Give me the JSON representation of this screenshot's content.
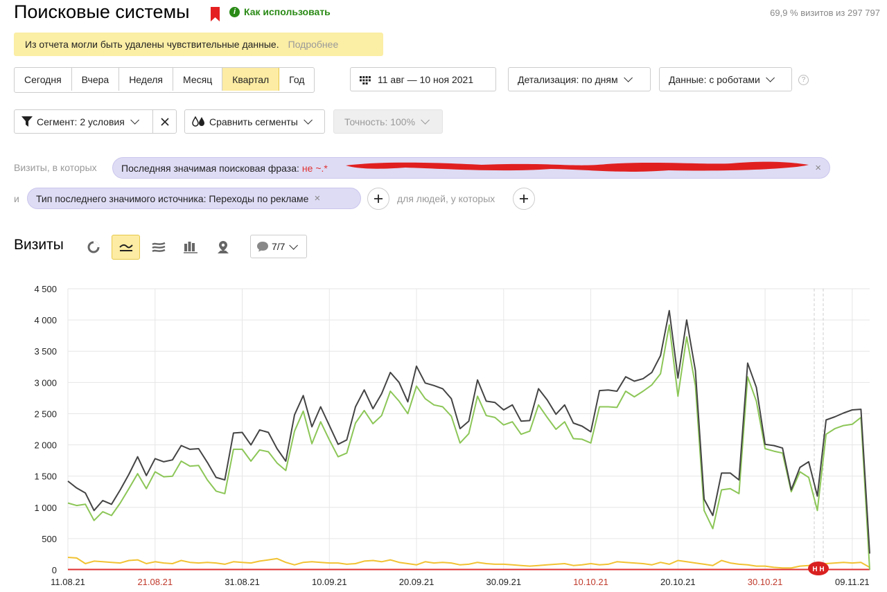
{
  "header": {
    "title": "Поисковые системы",
    "how_to_use": "Как использовать",
    "visits_summary": "69,9 % визитов из 297 797"
  },
  "notice": {
    "text": "Из отчета могли быть удалены чувствительные данные.",
    "more_link": "Подробнее"
  },
  "periods": [
    "Сегодня",
    "Вчера",
    "Неделя",
    "Месяц",
    "Квартал",
    "Год"
  ],
  "active_period": "Квартал",
  "date_range": "11 авг — 10 ноя 2021",
  "detail_dropdown": "Детализация: по дням",
  "data_dropdown": "Данные: с роботами",
  "help_glyph": "?",
  "segment_button": "Сегмент: 2 условия",
  "compare_button": "Сравнить сегменты",
  "accuracy_button": "Точность: 100%",
  "filters": {
    "visits_where": "Визиты, в которых",
    "cond1_prefix": "Последняя значимая поисковая фраза:",
    "cond1_neg": "не ~.*",
    "and_label": "и",
    "cond2": "Тип последнего значимого источника: Переходы по рекламе",
    "people_where": "для людей, у которых",
    "close_glyph": "×"
  },
  "chart_section": {
    "title": "Визиты",
    "series_count": "7/7"
  },
  "colors": {
    "accent": "#fdeca3",
    "dark_series": "#444444",
    "green_series": "#8cc657",
    "yellow_series": "#f1c232",
    "red_series": "#e03030",
    "chip_bg": "#dedcf5",
    "red_date": "#c0392b",
    "redacted": "#e02020"
  },
  "icons": [
    "bookmark-icon",
    "info-icon",
    "calendar-icon",
    "filter-icon",
    "compare-icon",
    "chevron-down-icon",
    "close-icon",
    "plus-icon",
    "pie-chart-icon",
    "line-chart-icon",
    "area-chart-icon",
    "bar-chart-icon",
    "map-icon",
    "comment-icon"
  ],
  "chart_data": {
    "type": "line",
    "ylabel": "",
    "xlabel": "",
    "ylim": [
      0,
      4500
    ],
    "yticks": [
      "4 500",
      "4 000",
      "3 500",
      "3 000",
      "2 500",
      "2 000",
      "1 500",
      "1 000",
      "500",
      "0"
    ],
    "xticks": [
      {
        "label": "11.08.21",
        "red": false
      },
      {
        "label": "21.08.21",
        "red": true
      },
      {
        "label": "31.08.21",
        "red": false
      },
      {
        "label": "10.09.21",
        "red": false
      },
      {
        "label": "20.09.21",
        "red": false
      },
      {
        "label": "30.09.21",
        "red": false
      },
      {
        "label": "10.10.21",
        "red": true
      },
      {
        "label": "20.10.21",
        "red": false
      },
      {
        "label": "30.10.21",
        "red": true
      },
      {
        "label": "09.11.21",
        "red": false
      }
    ],
    "x_start": "2021-08-11",
    "annotation_badge": "Н Н",
    "grid": true,
    "series": [
      {
        "values": [
          1420,
          1310,
          1230,
          950,
          1110,
          1050,
          1280,
          1530,
          1810,
          1510,
          1780,
          1730,
          1760,
          1990,
          1930,
          1940,
          1720,
          1480,
          1440,
          2190,
          2200,
          2000,
          2240,
          2200,
          1940,
          1740,
          2480,
          2790,
          2290,
          2610,
          2310,
          2010,
          2080,
          2610,
          2880,
          2580,
          2820,
          3160,
          3000,
          2690,
          3260,
          2990,
          2950,
          2900,
          2740,
          2260,
          2380,
          3040,
          2700,
          2680,
          2560,
          2640,
          2380,
          2390,
          2900,
          2720,
          2490,
          2640,
          2350,
          2300,
          2210,
          2870,
          2880,
          2860,
          3090,
          3020,
          3060,
          3160,
          3430,
          4150,
          3070,
          4000,
          3190,
          1130,
          870,
          1550,
          1550,
          1440,
          3310,
          2920,
          2010,
          1990,
          1950,
          1280,
          1640,
          1730,
          1180,
          2400,
          2450,
          2510,
          2560,
          2570,
          260
        ]
      },
      {
        "values": [
          1070,
          1030,
          1050,
          790,
          930,
          870,
          1070,
          1300,
          1540,
          1300,
          1570,
          1490,
          1500,
          1740,
          1660,
          1670,
          1440,
          1260,
          1220,
          1930,
          1930,
          1740,
          1920,
          1890,
          1710,
          1590,
          2220,
          2540,
          2020,
          2370,
          2080,
          1810,
          1870,
          2350,
          2550,
          2340,
          2470,
          2860,
          2700,
          2500,
          2940,
          2740,
          2640,
          2610,
          2460,
          2030,
          2180,
          2780,
          2470,
          2440,
          2320,
          2370,
          2170,
          2220,
          2640,
          2440,
          2250,
          2370,
          2100,
          2090,
          2030,
          2610,
          2610,
          2600,
          2860,
          2770,
          2860,
          2960,
          3140,
          3920,
          2780,
          3730,
          2950,
          950,
          660,
          1280,
          1300,
          1220,
          3090,
          2700,
          1940,
          1900,
          1870,
          1250,
          1570,
          1480,
          950,
          2170,
          2260,
          2310,
          2330,
          2440,
          0
        ]
      },
      {
        "values": [
          200,
          190,
          100,
          140,
          130,
          120,
          110,
          150,
          160,
          100,
          130,
          110,
          100,
          150,
          120,
          110,
          120,
          110,
          90,
          130,
          120,
          110,
          140,
          160,
          180,
          120,
          80,
          120,
          130,
          120,
          110,
          110,
          90,
          100,
          140,
          150,
          130,
          160,
          120,
          100,
          80,
          130,
          110,
          120,
          110,
          80,
          90,
          120,
          100,
          90,
          90,
          80,
          70,
          60,
          70,
          80,
          90,
          100,
          70,
          80,
          100,
          80,
          90,
          130,
          120,
          110,
          100,
          80,
          120,
          90,
          150,
          130,
          110,
          90,
          70,
          150,
          110,
          90,
          80,
          60,
          60,
          40,
          30,
          30,
          60,
          70,
          110,
          100,
          110,
          120,
          110,
          120,
          40
        ]
      },
      {
        "values": [
          5,
          5,
          5,
          5,
          5,
          5,
          5,
          5,
          5,
          5,
          5,
          5,
          5,
          5,
          5,
          5,
          5,
          5,
          5,
          5,
          5,
          5,
          5,
          5,
          5,
          5,
          5,
          5,
          5,
          5,
          5,
          5,
          5,
          5,
          5,
          5,
          5,
          5,
          5,
          5,
          5,
          5,
          5,
          5,
          5,
          5,
          5,
          5,
          5,
          5,
          5,
          5,
          5,
          5,
          5,
          5,
          5,
          5,
          5,
          5,
          5,
          5,
          5,
          5,
          5,
          5,
          5,
          5,
          5,
          5,
          5,
          5,
          5,
          5,
          5,
          5,
          5,
          5,
          5,
          5,
          5,
          5,
          5,
          5,
          5,
          5,
          5,
          5,
          5,
          5,
          5,
          5,
          5
        ]
      }
    ]
  }
}
